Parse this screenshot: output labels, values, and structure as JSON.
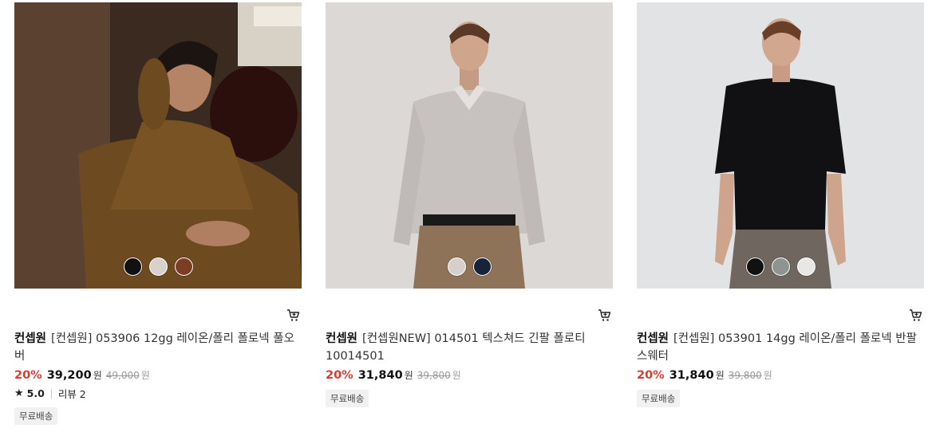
{
  "products": [
    {
      "brand": "컨셉원",
      "name": "[컨셉원] 053906 12gg 레이온/폴리 폴로넥 풀오버",
      "discount": "20%",
      "sale_price": "39,200",
      "currency": "원",
      "original_price": "49,000",
      "rating": "5.0",
      "review_text": "리뷰 2",
      "badge": "무료배송",
      "swatches": [
        "#111111",
        "#d8d0cc",
        "#7b3d24"
      ]
    },
    {
      "brand": "컨셉원",
      "name": "[컨셉원NEW] 014501 텍스쳐드 긴팔 폴로티 10014501",
      "discount": "20%",
      "sale_price": "31,840",
      "currency": "원",
      "original_price": "39,800",
      "badge": "무료배송",
      "swatches": [
        "#d6d0cd",
        "#172338"
      ]
    },
    {
      "brand": "컨셉원",
      "name": "[컨셉원] 053901 14gg 레이온/폴리 폴로넥 반팔 스웨터",
      "discount": "20%",
      "sale_price": "31,840",
      "currency": "원",
      "original_price": "39,800",
      "badge": "무료배송",
      "swatches": [
        "#111111",
        "#8e9590",
        "#e9e7e6"
      ]
    }
  ],
  "icons": {
    "cart": "cart-icon",
    "star": "star-icon"
  },
  "colors": {
    "discount": "#e5372c",
    "badge_bg": "#f1f1f1"
  }
}
